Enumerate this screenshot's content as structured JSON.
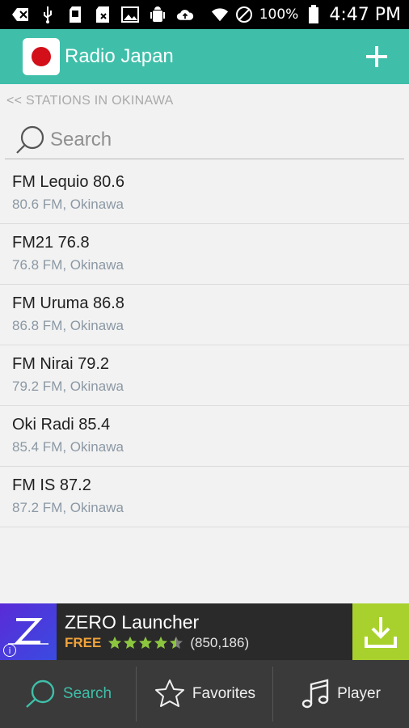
{
  "status_bar": {
    "battery_percent": "100%",
    "time": "4:47 PM",
    "icons": [
      "back-icon",
      "usb-icon",
      "sd-card-icon",
      "sim-icon",
      "image-icon",
      "android-debug-icon",
      "cloud-upload-icon",
      "wifi-icon",
      "do-not-disturb-icon",
      "battery-icon"
    ]
  },
  "app_bar": {
    "title": "Radio Japan",
    "logo_icon": "japan-flag-icon",
    "add_icon": "plus-icon",
    "color": "#3fbfa9"
  },
  "breadcrumb": {
    "label": "<< STATIONS IN OKINAWA"
  },
  "search": {
    "placeholder": "Search",
    "value": ""
  },
  "stations": [
    {
      "name": "FM Lequio 80.6",
      "subtitle": "80.6 FM, Okinawa"
    },
    {
      "name": "FM21 76.8",
      "subtitle": "76.8 FM, Okinawa"
    },
    {
      "name": "FM Uruma 86.8",
      "subtitle": "86.8 FM, Okinawa"
    },
    {
      "name": "FM Nirai 79.2",
      "subtitle": "79.2 FM, Okinawa"
    },
    {
      "name": "Oki Radi 85.4",
      "subtitle": "85.4 FM, Okinawa"
    },
    {
      "name": "FM IS 87.2",
      "subtitle": "87.2 FM, Okinawa"
    }
  ],
  "ad": {
    "title": "ZERO Launcher",
    "free_label": "FREE",
    "rating": 4.5,
    "rating_count": "(850,186)",
    "download_icon": "download-icon",
    "colors": {
      "free": "#f2a33a",
      "download_bg": "#a8d12d"
    }
  },
  "bottom_nav": {
    "items": [
      {
        "label": "Search",
        "icon": "search-icon",
        "active": true
      },
      {
        "label": "Favorites",
        "icon": "star-icon",
        "active": false
      },
      {
        "label": "Player",
        "icon": "music-note-icon",
        "active": false
      }
    ]
  }
}
